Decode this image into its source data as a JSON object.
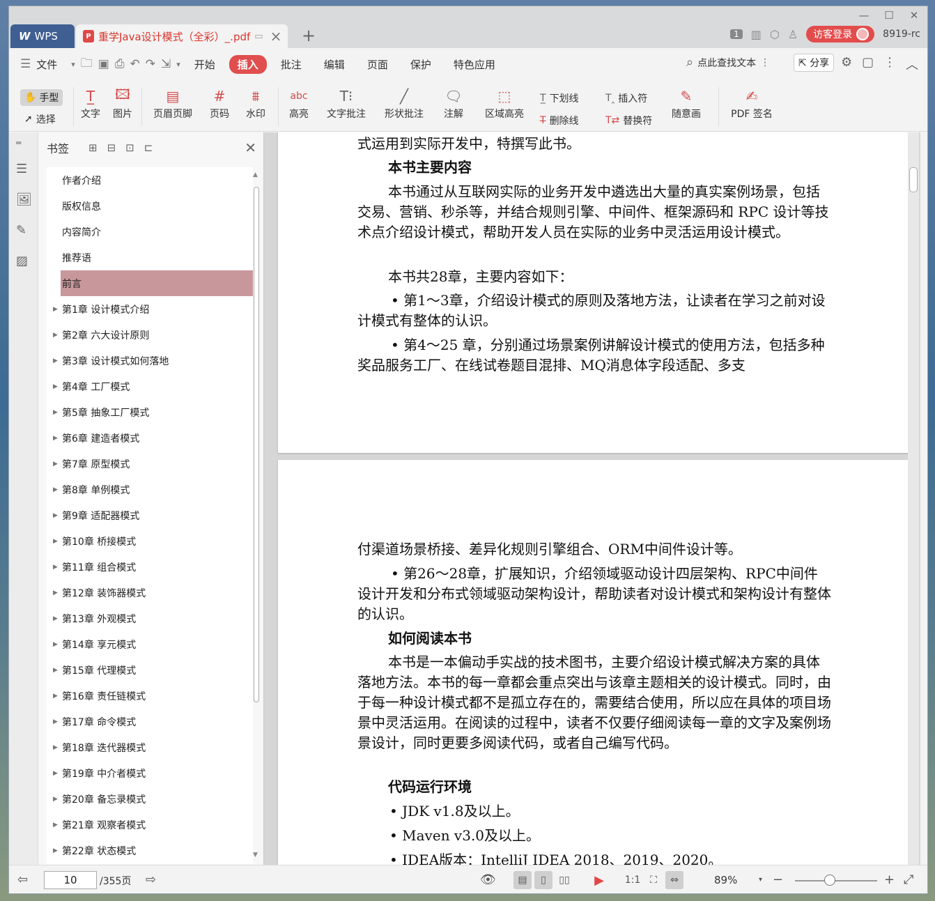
{
  "titlebar": {
    "wps_tab": "WPS",
    "doc_tab": "重学Java设计模式（全彩）_.pdf",
    "login": "访客登录",
    "user": "8919-rc",
    "badge": "1"
  },
  "menubar": {
    "file": "文件",
    "items": [
      "开始",
      "插入",
      "批注",
      "编辑",
      "页面",
      "保护",
      "特色应用"
    ],
    "active": "插入",
    "search": "点此查找文本",
    "share": "分享"
  },
  "toolbar": {
    "hand": "手型",
    "select": "选择",
    "text": "文字",
    "image": "图片",
    "header_footer": "页眉页脚",
    "page_num": "页码",
    "watermark": "水印",
    "highlight": "高亮",
    "text_annot": "文字批注",
    "shape_annot": "形状批注",
    "note": "注解",
    "area_highlight": "区域高亮",
    "underline": "下划线",
    "strikethrough": "删除线",
    "insert_mark": "插入符",
    "replace_mark": "替换符",
    "freehand": "随意画",
    "pdf_sign": "PDF 签名"
  },
  "bookmarks": {
    "title": "书签",
    "items": [
      {
        "label": "作者介绍",
        "expandable": false
      },
      {
        "label": "版权信息",
        "expandable": false
      },
      {
        "label": "内容简介",
        "expandable": false
      },
      {
        "label": "推荐语",
        "expandable": false
      },
      {
        "label": "前言",
        "expandable": false,
        "selected": true
      },
      {
        "label": "第1章 设计模式介绍",
        "expandable": true
      },
      {
        "label": "第2章 六大设计原则",
        "expandable": true
      },
      {
        "label": "第3章 设计模式如何落地",
        "expandable": true
      },
      {
        "label": "第4章 工厂模式",
        "expandable": true
      },
      {
        "label": "第5章 抽象工厂模式",
        "expandable": true
      },
      {
        "label": "第6章 建造者模式",
        "expandable": true
      },
      {
        "label": "第7章 原型模式",
        "expandable": true
      },
      {
        "label": "第8章 单例模式",
        "expandable": true
      },
      {
        "label": "第9章 适配器模式",
        "expandable": true
      },
      {
        "label": "第10章 桥接模式",
        "expandable": true
      },
      {
        "label": "第11章 组合模式",
        "expandable": true
      },
      {
        "label": "第12章 装饰器模式",
        "expandable": true
      },
      {
        "label": "第13章 外观模式",
        "expandable": true
      },
      {
        "label": "第14章 享元模式",
        "expandable": true
      },
      {
        "label": "第15章 代理模式",
        "expandable": true
      },
      {
        "label": "第16章 责任链模式",
        "expandable": true
      },
      {
        "label": "第17章 命令模式",
        "expandable": true
      },
      {
        "label": "第18章 迭代器模式",
        "expandable": true
      },
      {
        "label": "第19章 中介者模式",
        "expandable": true
      },
      {
        "label": "第20章 备忘录模式",
        "expandable": true
      },
      {
        "label": "第21章 观察者模式",
        "expandable": true
      },
      {
        "label": "第22章 状态模式",
        "expandable": true
      }
    ]
  },
  "page1": {
    "p0": "式运用到实际开发中，特撰写此书。",
    "h1": "本书主要内容",
    "p1": "本书通过从互联网实际的业务开发中遴选出大量的真实案例场景，包括交易、营销、秒杀等，并结合规则引擎、中间件、框架源码和 RPC 设计等技术点介绍设计模式，帮助开发人员在实际的业务中灵活运用设计模式。",
    "p2": "本书共28章，主要内容如下：",
    "b1": "• 第1～3章，介绍设计模式的原则及落地方法，让读者在学习之前对设计模式有整体的认识。",
    "b2": "• 第4～25 章，分别通过场景案例讲解设计模式的使用方法，包括多种奖品服务工厂、在线试卷题目混排、MQ消息体字段适配、多支"
  },
  "page2": {
    "p0": "付渠道场景桥接、差异化规则引擎组合、ORM中间件设计等。",
    "b3": "• 第26～28章，扩展知识，介绍领域驱动设计四层架构、RPC中间件设计开发和分布式领域驱动架构设计，帮助读者对设计模式和架构设计有整体的认识。",
    "h2": "如何阅读本书",
    "p3": "本书是一本偏动手实战的技术图书，主要介绍设计模式解决方案的具体落地方法。本书的每一章都会重点突出与该章主题相关的设计模式。同时，由于每一种设计模式都不是孤立存在的，需要结合使用，所以应在具体的项目场景中灵活运用。在阅读的过程中，读者不仅要仔细阅读每一章的文字及案例场景设计，同时更要多阅读代码，或者自己编写代码。",
    "h3": "代码运行环境",
    "l1": "• JDK v1.8及以上。",
    "l2": "• Maven v3.0及以上。",
    "l3": "• IDEA版本：IntelliJ IDEA 2018、2019、2020。"
  },
  "status": {
    "page": "10",
    "total": "/355页",
    "zoom": "89%"
  }
}
